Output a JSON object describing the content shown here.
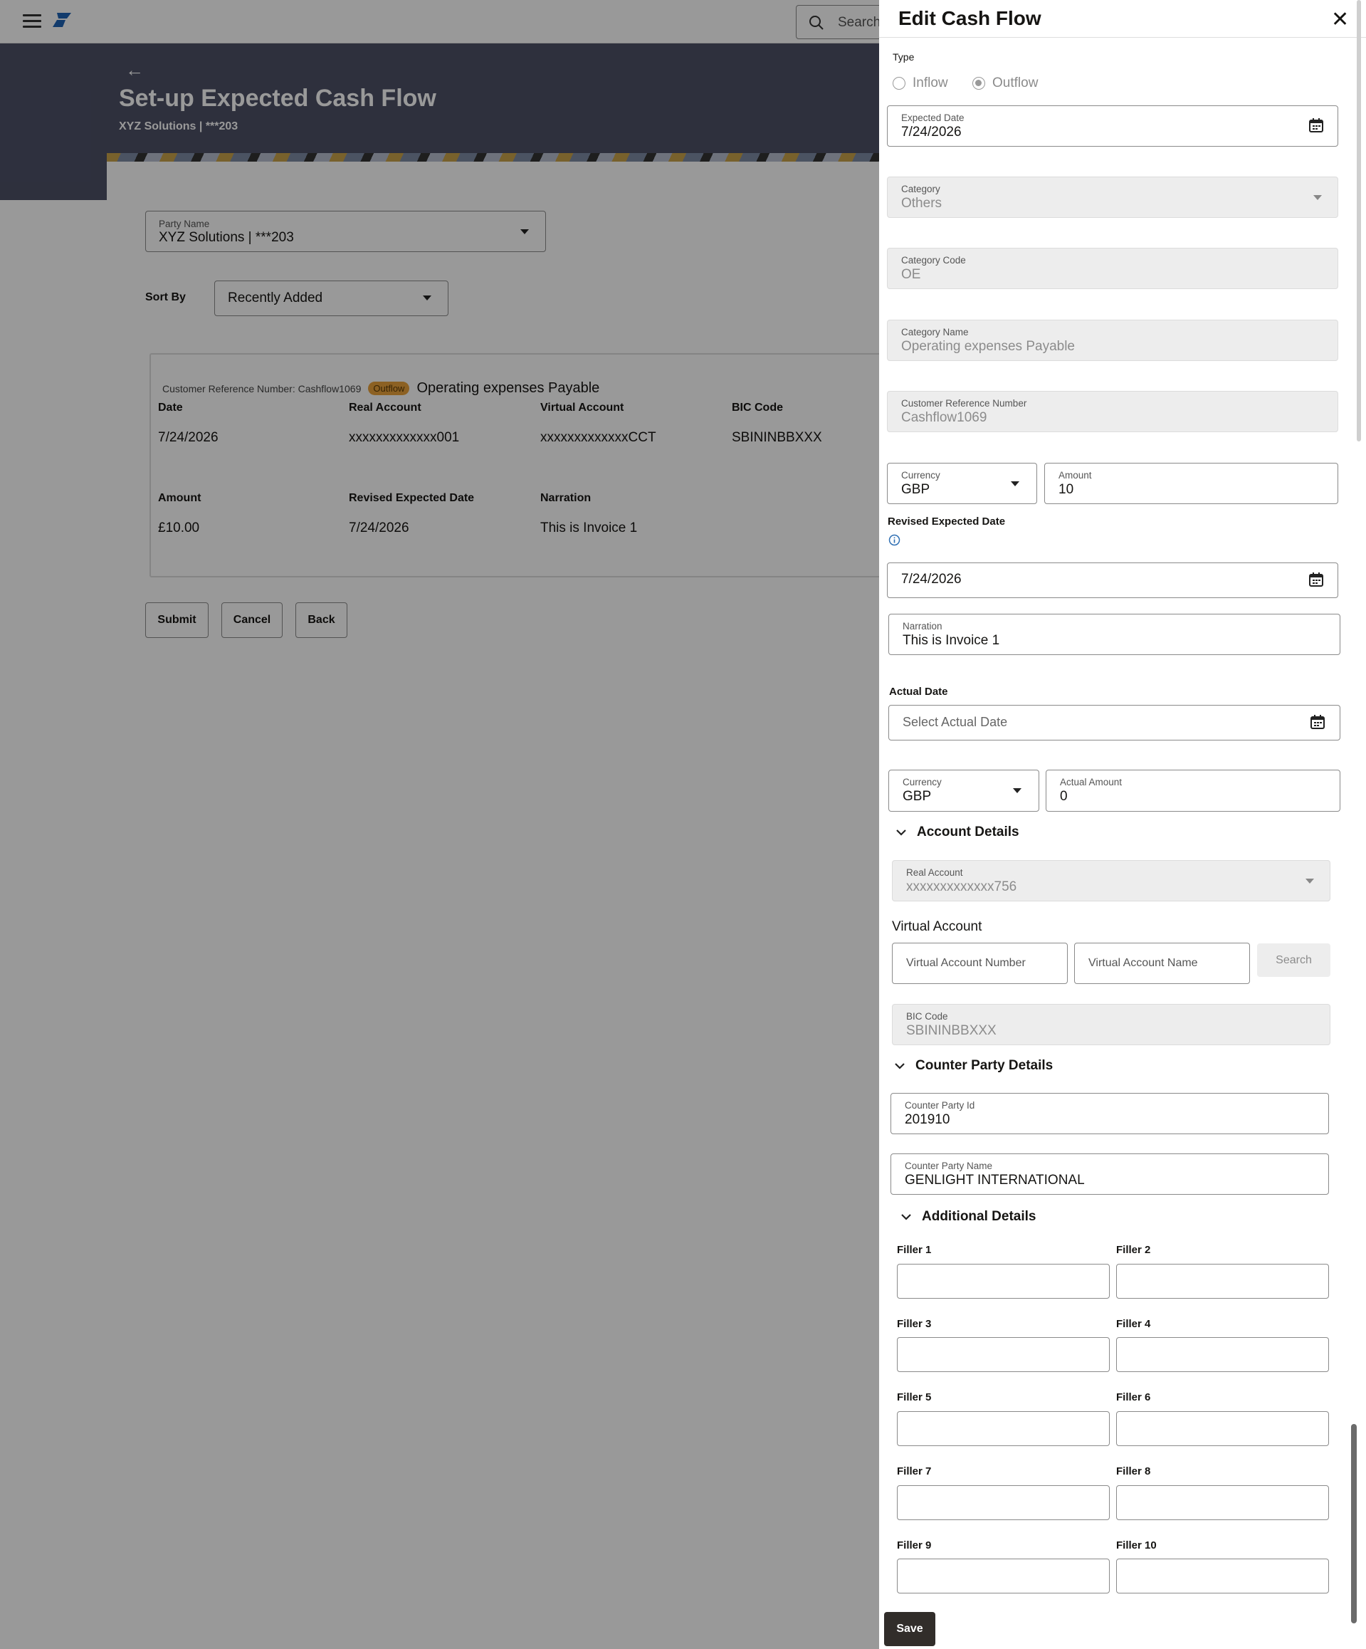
{
  "topbar": {
    "search_placeholder": "Search"
  },
  "page": {
    "back_icon": "back-arrow-icon",
    "title": "Set-up Expected Cash Flow",
    "subtitle": "XYZ Solutions | ***203"
  },
  "filters": {
    "party_label": "Party Name",
    "party_value": "XYZ Solutions | ***203",
    "sort_label": "Sort By",
    "sort_value": "Recently Added"
  },
  "card": {
    "ref_text": "Customer Reference Number: Cashflow1069",
    "badge": "Outflow",
    "title": "Operating expenses Payable",
    "labels": {
      "date": "Date",
      "real_account": "Real Account",
      "virtual_account": "Virtual Account",
      "bic": "BIC Code",
      "amount": "Amount",
      "revised_date": "Revised Expected Date",
      "narration": "Narration"
    },
    "values": {
      "date": "7/24/2026",
      "real_account": "xxxxxxxxxxxxx001",
      "virtual_account": "xxxxxxxxxxxxxCCT",
      "bic": "SBININBBXXX",
      "amount": "£10.00",
      "revised_date": "7/24/2026",
      "narration": "This is Invoice 1"
    }
  },
  "buttons": {
    "submit": "Submit",
    "cancel": "Cancel",
    "back": "Back"
  },
  "drawer": {
    "title": "Edit Cash Flow",
    "type_label": "Type",
    "inflow": "Inflow",
    "outflow": "Outflow",
    "selected_type": "Outflow",
    "expected_date": {
      "label": "Expected Date",
      "value": "7/24/2026"
    },
    "category": {
      "label": "Category",
      "value": "Others"
    },
    "category_code": {
      "label": "Category Code",
      "value": "OE"
    },
    "category_name": {
      "label": "Category Name",
      "value": "Operating expenses Payable"
    },
    "customer_ref": {
      "label": "Customer Reference Number",
      "value": "Cashflow1069"
    },
    "currency": {
      "label": "Currency",
      "value": "GBP"
    },
    "amount": {
      "label": "Amount",
      "value": "10"
    },
    "revised_date": {
      "label": "Revised Expected Date",
      "value": "7/24/2026"
    },
    "narration": {
      "label": "Narration",
      "value": "This is Invoice 1"
    },
    "actual_date": {
      "label": "Actual Date",
      "placeholder": "Select Actual Date"
    },
    "actual_currency": {
      "label": "Currency",
      "value": "GBP"
    },
    "actual_amount": {
      "label": "Actual Amount",
      "value": "0"
    },
    "account_section": "Account Details",
    "real_account": {
      "label": "Real Account",
      "value": "xxxxxxxxxxxxx756"
    },
    "virtual_account_label": "Virtual Account",
    "va_number_placeholder": "Virtual Account Number",
    "va_name_placeholder": "Virtual Account Name",
    "search_button": "Search",
    "bic": {
      "label": "BIC Code",
      "value": "SBININBBXXX"
    },
    "counter_section": "Counter Party Details",
    "counter_id": {
      "label": "Counter Party Id",
      "value": "201910"
    },
    "counter_name": {
      "label": "Counter Party Name",
      "value": "GENLIGHT INTERNATIONAL"
    },
    "additional_section": "Additional Details",
    "fillers": [
      "Filler 1",
      "Filler 2",
      "Filler 3",
      "Filler 4",
      "Filler 5",
      "Filler 6",
      "Filler 7",
      "Filler 8",
      "Filler 9",
      "Filler 10"
    ],
    "save": "Save"
  },
  "colors": {
    "hero": "#4d5067",
    "badge": "#e9a23b",
    "save": "#312d2a",
    "info": "#2f6fb3"
  }
}
